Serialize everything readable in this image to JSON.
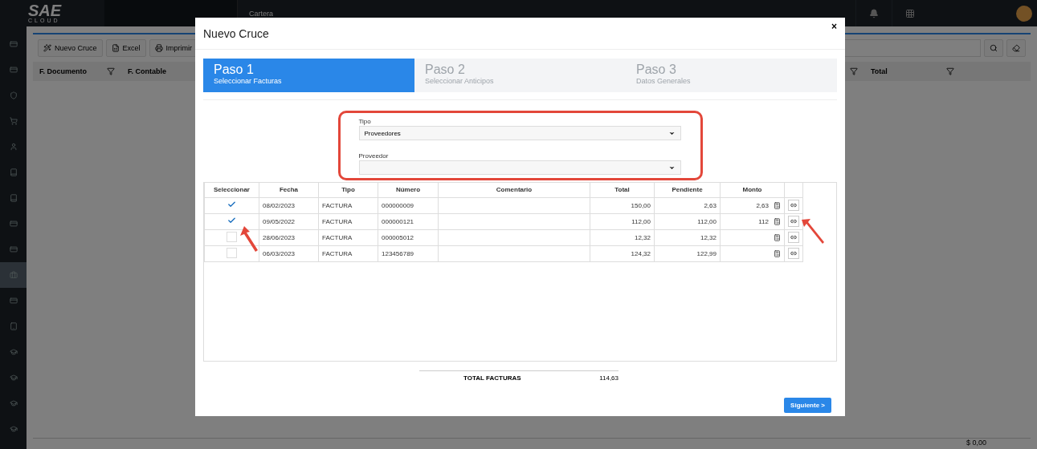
{
  "app": {
    "logo": "SAE",
    "logo_sub": "CLOUD",
    "module": "Cartera"
  },
  "sidebar": {
    "items": [
      {
        "selected": false
      },
      {
        "selected": false
      },
      {
        "selected": false
      },
      {
        "selected": false
      },
      {
        "selected": false
      },
      {
        "selected": false
      },
      {
        "selected": false
      },
      {
        "selected": false
      },
      {
        "selected": false
      },
      {
        "selected": true
      },
      {
        "selected": false
      },
      {
        "selected": false
      },
      {
        "selected": false
      },
      {
        "selected": false
      },
      {
        "selected": false
      },
      {
        "selected": false
      }
    ]
  },
  "toolbar": {
    "buttons": [
      "Nuevo Cruce",
      "Excel",
      "Imprimir"
    ]
  },
  "grid": {
    "columns": [
      "F. Documento",
      "F. Contable",
      "Total"
    ],
    "footer_total": "$ 0,00"
  },
  "dialog": {
    "title": "Nuevo Cruce",
    "close": "×",
    "steps": [
      {
        "title": "Paso 1",
        "subtitle": "Seleccionar Facturas",
        "selected": true
      },
      {
        "title": "Paso 2",
        "subtitle": "Seleccionar Anticipos",
        "selected": false
      },
      {
        "title": "Paso 3",
        "subtitle": "Datos Generales",
        "selected": false
      }
    ],
    "tipo": {
      "label": "Tipo",
      "value": "Proveedores"
    },
    "proveedor": {
      "label": "Proveedor"
    },
    "table": {
      "columns": [
        "Seleccionar",
        "Fecha",
        "Tipo",
        "Número",
        "Comentario",
        "Total",
        "Pendiente",
        "Monto"
      ],
      "rows": [
        {
          "checked": true,
          "fecha": "08/02/2023",
          "tipo": "FACTURA",
          "numero": "000000009",
          "total": "150,00",
          "pendiente": "2,63",
          "monto": "2,63"
        },
        {
          "checked": true,
          "fecha": "09/05/2022",
          "tipo": "FACTURA",
          "numero": "000000121",
          "total": "112,00",
          "pendiente": "112,00",
          "monto": "112"
        },
        {
          "checked": false,
          "fecha": "28/06/2023",
          "tipo": "FACTURA",
          "numero": "000005012",
          "total": "12,32",
          "pendiente": "12,32"
        },
        {
          "checked": false,
          "fecha": "06/03/2023",
          "tipo": "FACTURA",
          "numero": "123456789",
          "total": "124,32",
          "pendiente": "122,99"
        }
      ]
    },
    "total": {
      "label": "TOTAL FACTURAS",
      "value": "114,63"
    },
    "next_button": "Siguiente >"
  }
}
